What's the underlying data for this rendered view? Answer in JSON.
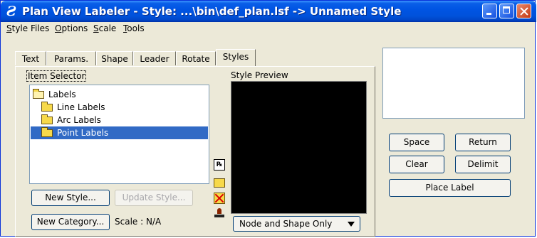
{
  "titlebar": {
    "title": "Plan View Labeler - Style: ...\\bin\\def_plan.lsf -> Unnamed Style",
    "app_icon": "plan-view-labeler-icon",
    "color": "#0054e3"
  },
  "menubar": {
    "items": [
      "Style Files",
      "Options",
      "Scale",
      "Tools"
    ]
  },
  "tabs": [
    "Text",
    "Params.",
    "Shape",
    "Leader",
    "Rotate",
    "Styles"
  ],
  "active_tab": "Styles",
  "item_selector": {
    "label": "Item Selector",
    "tree": [
      {
        "label": "Labels",
        "level": 0,
        "icon": "folder-open-icon"
      },
      {
        "label": "Line Labels",
        "level": 1,
        "icon": "folder-icon"
      },
      {
        "label": "Arc Labels",
        "level": 1,
        "icon": "folder-icon"
      },
      {
        "label": "Point Labels",
        "level": 1,
        "icon": "folder-icon",
        "selected": true
      }
    ],
    "selection_color": "#316ac5"
  },
  "buttons": {
    "new_style": "New Style...",
    "update_style": "Update Style...",
    "new_category": "New Category...",
    "space": "Space",
    "return": "Return",
    "clear": "Clear",
    "delimit": "Delimit",
    "place_label": "Place Label"
  },
  "scale_text": "Scale : N/A",
  "style_preview": {
    "label": "Style Preview",
    "background": "#000000",
    "shape_option": "Node and Shape Only"
  },
  "side_icons": [
    "properties-icon",
    "folder-icon",
    "delete-folder-icon",
    "stamp-icon"
  ]
}
